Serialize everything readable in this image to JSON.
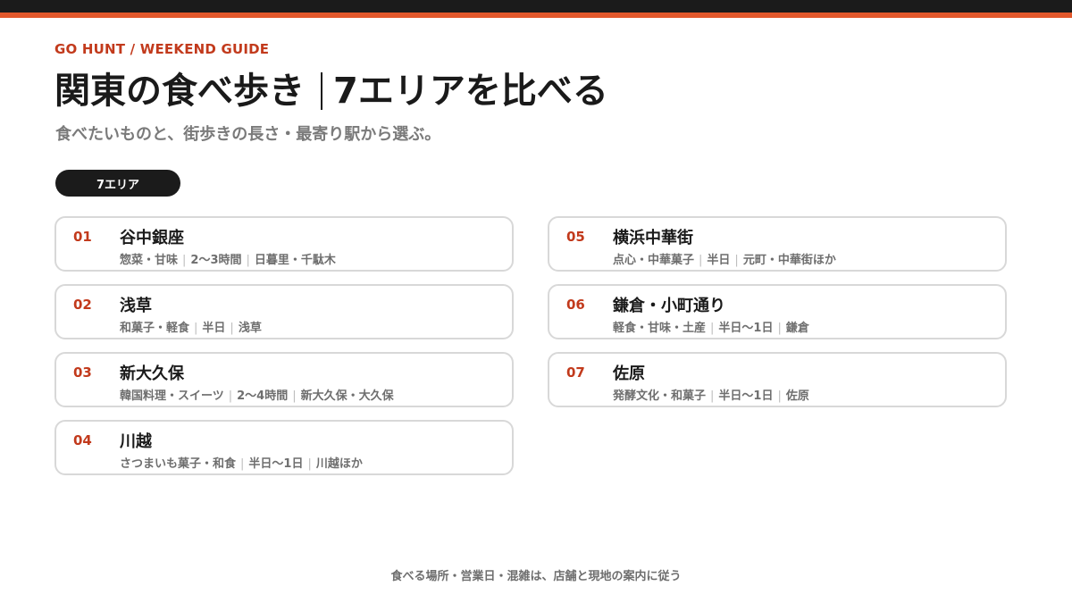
{
  "header": {
    "kicker": "GO HUNT / WEEKEND GUIDE",
    "title_main": "関東の食べ歩き",
    "title_sub": "7エリアを比べる",
    "subtitle": "食べたいものと、街歩きの長さ・最寄り駅から選ぶ。"
  },
  "filter": {
    "pill_label": "7エリア"
  },
  "areas": [
    {
      "num": "01",
      "name": "谷中銀座",
      "food": "惣菜・甘味",
      "duration": "2〜3時間",
      "station": "日暮里・千駄木"
    },
    {
      "num": "02",
      "name": "浅草",
      "food": "和菓子・軽食",
      "duration": "半日",
      "station": "浅草"
    },
    {
      "num": "03",
      "name": "新大久保",
      "food": "韓国料理・スイーツ",
      "duration": "2〜4時間",
      "station": "新大久保・大久保"
    },
    {
      "num": "04",
      "name": "川越",
      "food": "さつまいも菓子・和食",
      "duration": "半日〜1日",
      "station": "川越ほか"
    },
    {
      "num": "05",
      "name": "横浜中華街",
      "food": "点心・中華菓子",
      "duration": "半日",
      "station": "元町・中華街ほか"
    },
    {
      "num": "06",
      "name": "鎌倉・小町通り",
      "food": "軽食・甘味・土産",
      "duration": "半日〜1日",
      "station": "鎌倉"
    },
    {
      "num": "07",
      "name": "佐原",
      "food": "発酵文化・和菓子",
      "duration": "半日〜1日",
      "station": "佐原"
    }
  ],
  "footer": {
    "note": "食べる場所・営業日・混雑は、店舗と現地の案内に従う"
  },
  "colors": {
    "accent": "#c23a1c",
    "accent_bar": "#e2582c",
    "dark": "#1b1b1b"
  }
}
